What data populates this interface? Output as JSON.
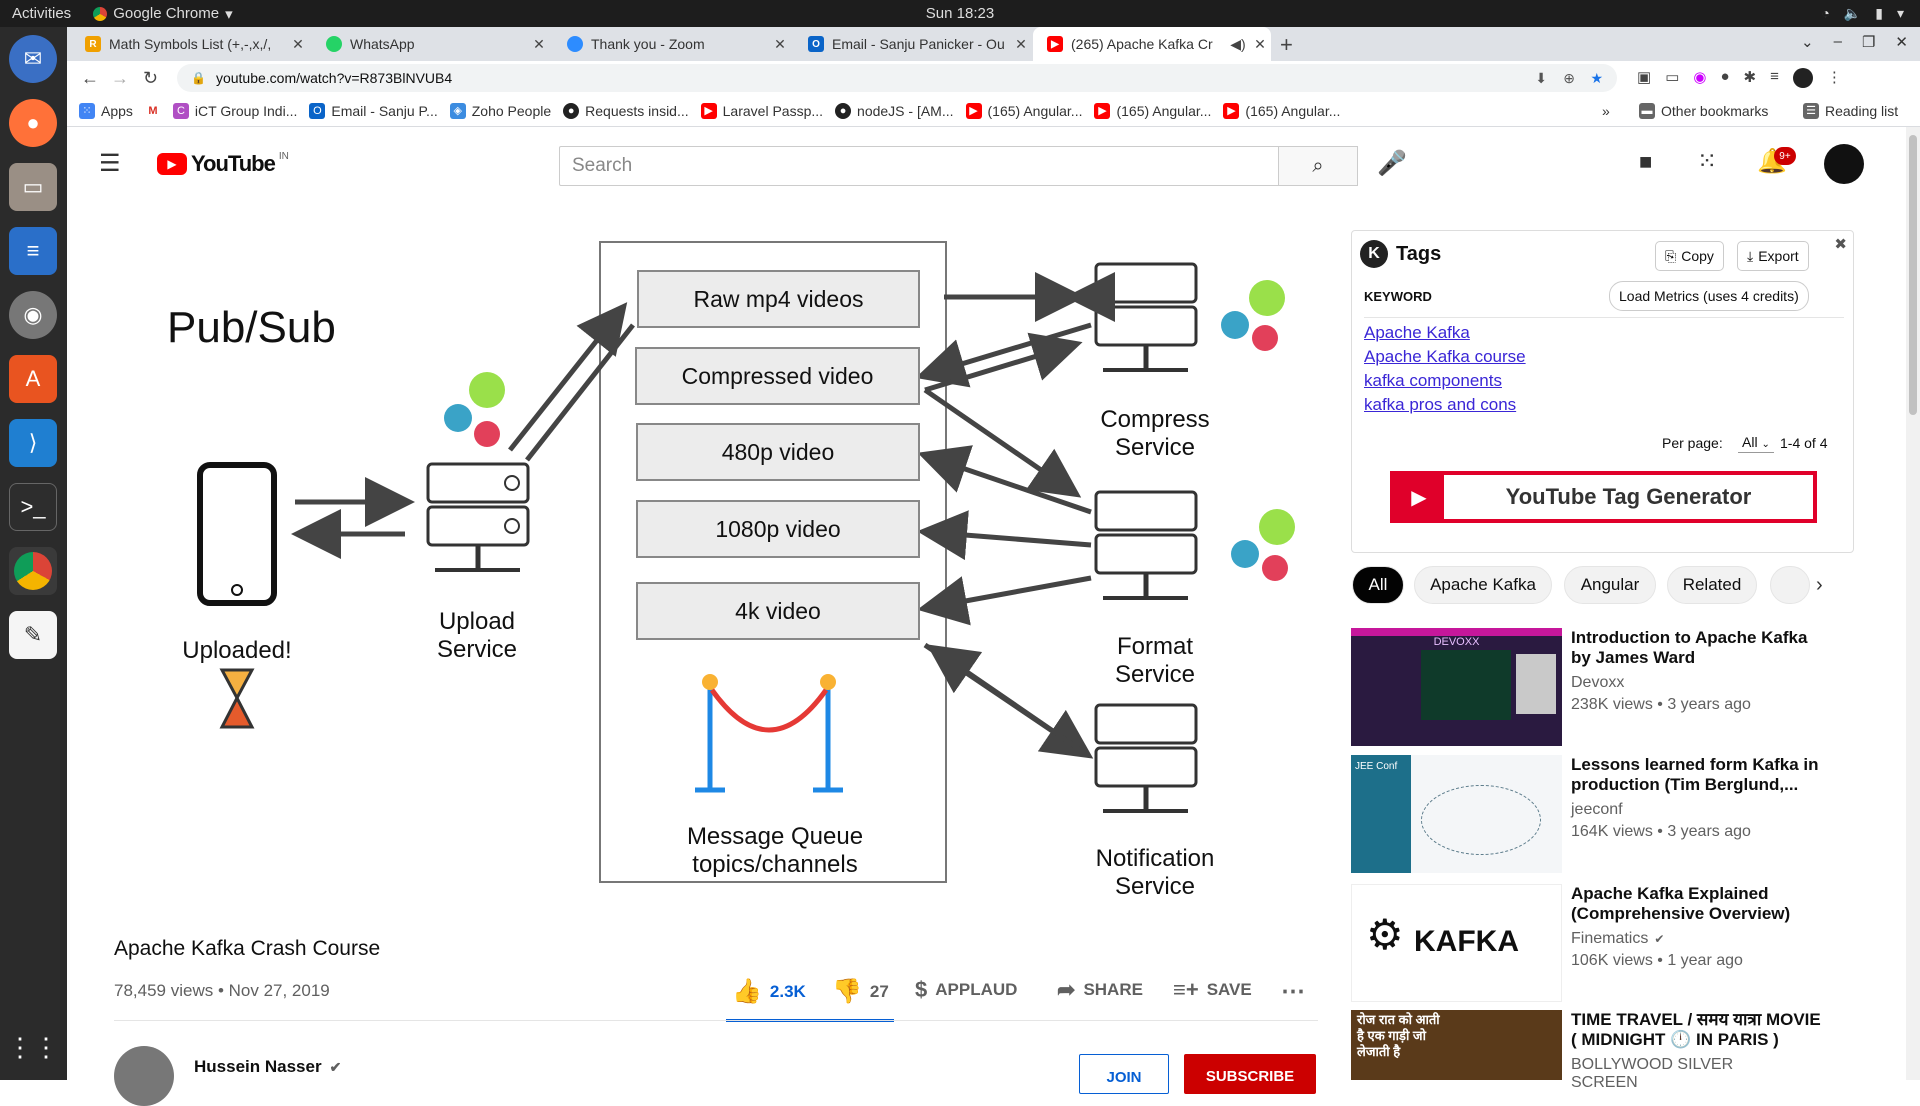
{
  "os": {
    "activities": "Activities",
    "app_name": "Google Chrome",
    "clock": "Sun 18:23"
  },
  "tabs": [
    {
      "title": "Math Symbols List (+,-,x,/,",
      "fav_color": "#f0a000",
      "fav_letter": "R"
    },
    {
      "title": "WhatsApp",
      "fav_color": "#25d366",
      "fav_letter": ""
    },
    {
      "title": "Thank you - Zoom",
      "fav_color": "#2d8cff",
      "fav_letter": ""
    },
    {
      "title": "Email - Sanju Panicker - Ou",
      "fav_color": "#0a64c8",
      "fav_letter": "O"
    },
    {
      "title": "(265) Apache Kafka Cr",
      "fav_color": "#ff0000",
      "fav_letter": ""
    }
  ],
  "url": "youtube.com/watch?v=R873BlNVUB4",
  "bookmarks": [
    {
      "label": "Apps",
      "color": "#4285f4"
    },
    {
      "label": "",
      "color": "#d93025"
    },
    {
      "label": "iCT Group Indi...",
      "color": "#b04fc4"
    },
    {
      "label": "Email - Sanju P...",
      "color": "#0a64c8"
    },
    {
      "label": "Zoho People",
      "color": "#3c8ce0"
    },
    {
      "label": "Requests insid...",
      "color": "#222"
    },
    {
      "label": "Laravel Passp...",
      "color": "#ff0000"
    },
    {
      "label": "nodeJS - [AM...",
      "color": "#222"
    },
    {
      "label": "(165) Angular...",
      "color": "#ff0000"
    },
    {
      "label": "(165) Angular...",
      "color": "#ff0000"
    },
    {
      "label": "(165) Angular...",
      "color": "#ff0000"
    }
  ],
  "bookmarks_overflow": "»",
  "other_bookmarks": "Other bookmarks",
  "reading_list": "Reading list",
  "youtube": {
    "logo": "YouTube",
    "region": "IN",
    "search_placeholder": "Search",
    "notif_badge": "9+"
  },
  "diagram": {
    "title": "Pub/Sub",
    "uploaded": "Uploaded!",
    "upload_service": [
      "Upload",
      "Service"
    ],
    "queues": [
      "Raw mp4 videos",
      "Compressed video",
      "480p video",
      "1080p video",
      "4k video"
    ],
    "mq_label": [
      "Message Queue",
      "topics/channels"
    ],
    "compress_service": [
      "Compress",
      "Service"
    ],
    "format_service": [
      "Format",
      "Service"
    ],
    "notification_service": [
      "Notification",
      "Service"
    ]
  },
  "video": {
    "title": "Apache Kafka Crash Course",
    "meta": "78,459 views • Nov 27, 2019",
    "likes": "2.3K",
    "dislikes": "27",
    "applaud": "APPLAUD",
    "share": "SHARE",
    "save": "SAVE",
    "channel": "Hussein Nasser",
    "join": "JOIN",
    "subscribe": "SUBSCRIBE"
  },
  "tags_panel": {
    "title": "Tags",
    "copy": "Copy",
    "export": "Export",
    "keyword_header": "KEYWORD",
    "load_metrics": "Load Metrics (uses 4 credits)",
    "keywords": [
      "Apache Kafka",
      "Apache Kafka course",
      "kafka components",
      "kafka pros and cons"
    ],
    "per_page_label": "Per page:",
    "per_page_value": "All",
    "range": "1-4 of 4",
    "banner": "YouTube Tag Generator"
  },
  "chips": [
    "All",
    "Apache Kafka",
    "Angular",
    "Related"
  ],
  "recommendations": [
    {
      "title": "Introduction to Apache Kafka by James Ward",
      "channel": "Devoxx",
      "stats": "238K views • 3 years ago",
      "thumb_text": "DEVOXX",
      "thumb_bg": "#2a1a40"
    },
    {
      "title": "Lessons learned form Kafka in production (Tim Berglund,...",
      "channel": "jeeconf",
      "stats": "164K views • 3 years ago",
      "thumb_text": "JEE Conf",
      "thumb_bg": "#1d6f8a"
    },
    {
      "title": "Apache Kafka Explained (Comprehensive Overview)",
      "channel": "Finematics",
      "stats": "106K views • 1 year ago",
      "thumb_text": "KAFKA",
      "thumb_bg": "#ffffff"
    },
    {
      "title": "TIME TRAVEL / समय यात्रा MOVIE ( MIDNIGHT 🕛 IN PARIS )",
      "channel": "BOLLYWOOD SILVER SCREEN",
      "stats": "",
      "thumb_text": "रोज रात को आती है एक गाड़ी जो लेजाती है",
      "thumb_bg": "#5a3a1a"
    }
  ]
}
